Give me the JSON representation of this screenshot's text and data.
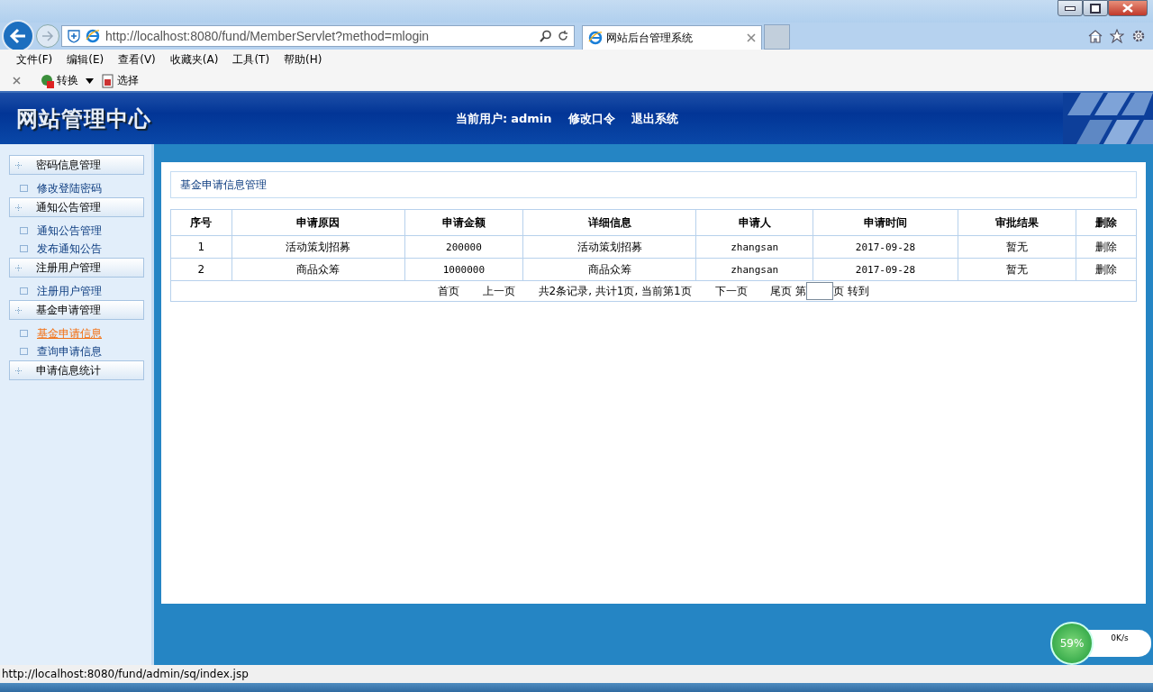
{
  "browser": {
    "address": "http://localhost:8080/fund/MemberServlet?method=mlogin",
    "tabs": [
      {
        "title": "网站后台管理系统",
        "selected": true
      }
    ],
    "menu": [
      "文件(F)",
      "编辑(E)",
      "查看(V)",
      "收藏夹(A)",
      "工具(T)",
      "帮助(H)"
    ],
    "toolbar": [
      "转换",
      "选择"
    ]
  },
  "header": {
    "logo": "网站管理中心",
    "user_label": "当前用户:",
    "user": "admin",
    "links": [
      "修改口令",
      "退出系统"
    ]
  },
  "sidebar": [
    {
      "title": "密码信息管理",
      "children": [
        {
          "label": "修改登陆密码",
          "selected": false
        }
      ]
    },
    {
      "title": "通知公告管理",
      "children": [
        {
          "label": "通知公告管理",
          "selected": false
        },
        {
          "label": "发布通知公告",
          "selected": false
        }
      ]
    },
    {
      "title": "注册用户管理",
      "children": [
        {
          "label": "注册用户管理",
          "selected": false
        }
      ]
    },
    {
      "title": "基金申请管理",
      "children": [
        {
          "label": "基金申请信息",
          "selected": true
        },
        {
          "label": "查询申请信息",
          "selected": false
        }
      ]
    },
    {
      "title": "申请信息统计"
    }
  ],
  "panel": {
    "title": "基金申请信息管理",
    "table": {
      "columns": [
        "序号",
        "申请原因",
        "申请金额",
        "详细信息",
        "申请人",
        "申请时间",
        "审批结果",
        "删除"
      ],
      "rows": [
        [
          "1",
          "活动策划招募",
          "200000",
          "活动策划招募",
          "zhangsan",
          "2017-09-28",
          "暂无",
          "删除"
        ],
        [
          "2",
          "商品众筹",
          "1000000",
          "商品众筹",
          "zhangsan",
          "2017-09-28",
          "暂无",
          "删除"
        ]
      ]
    },
    "pager": {
      "first": "首页",
      "prev": "上一页",
      "info": "共2条记录, 共计1页, 当前第1页",
      "next": "下一页",
      "last": "尾页",
      "page_prefix": "第",
      "page_suffix": "页",
      "go": "转到"
    }
  },
  "status_bar": "http://localhost:8080/fund/admin/sq/index.jsp",
  "net_widget": {
    "percent": "59%",
    "speed": "0K/s"
  }
}
